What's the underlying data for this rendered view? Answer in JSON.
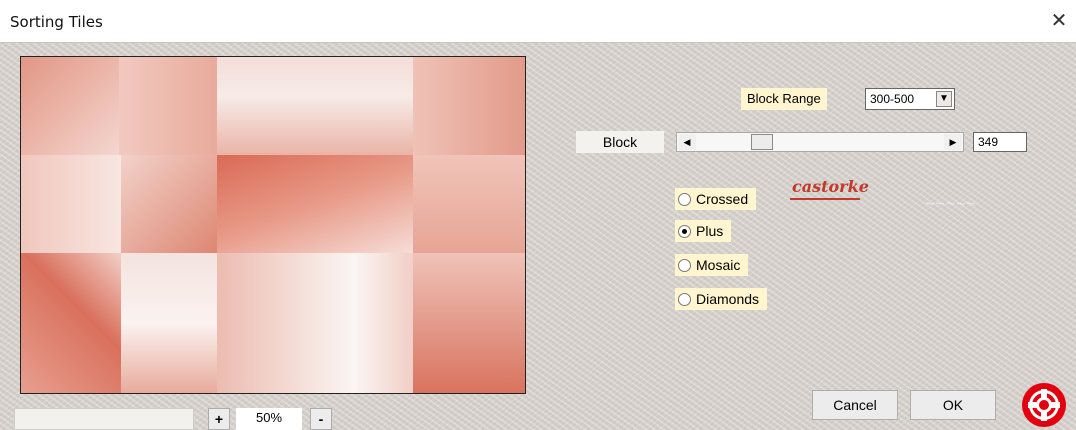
{
  "window": {
    "title": "Sorting Tiles"
  },
  "block_range": {
    "label": "Block Range",
    "value": "300-500"
  },
  "block": {
    "label": "Block",
    "value": "349",
    "slider_fraction": 0.31
  },
  "options": [
    {
      "label": "Crossed",
      "selected": false
    },
    {
      "label": "Plus",
      "selected": true
    },
    {
      "label": "Mosaic",
      "selected": false
    },
    {
      "label": "Diamonds",
      "selected": false
    }
  ],
  "logo": {
    "text": "castorke"
  },
  "buttons": {
    "cancel": "Cancel",
    "ok": "OK"
  },
  "zoom": {
    "plus": "+",
    "minus": "-",
    "value": "50%"
  },
  "icons": {
    "close": "close-icon",
    "help": "lifebuoy-icon",
    "dropdown": "chevron-down-icon"
  },
  "colors": {
    "preview_base": "#e4a090",
    "accent_red": "#c0392b",
    "panel": "#dad5d0",
    "label_bg": "#fff5cf"
  }
}
